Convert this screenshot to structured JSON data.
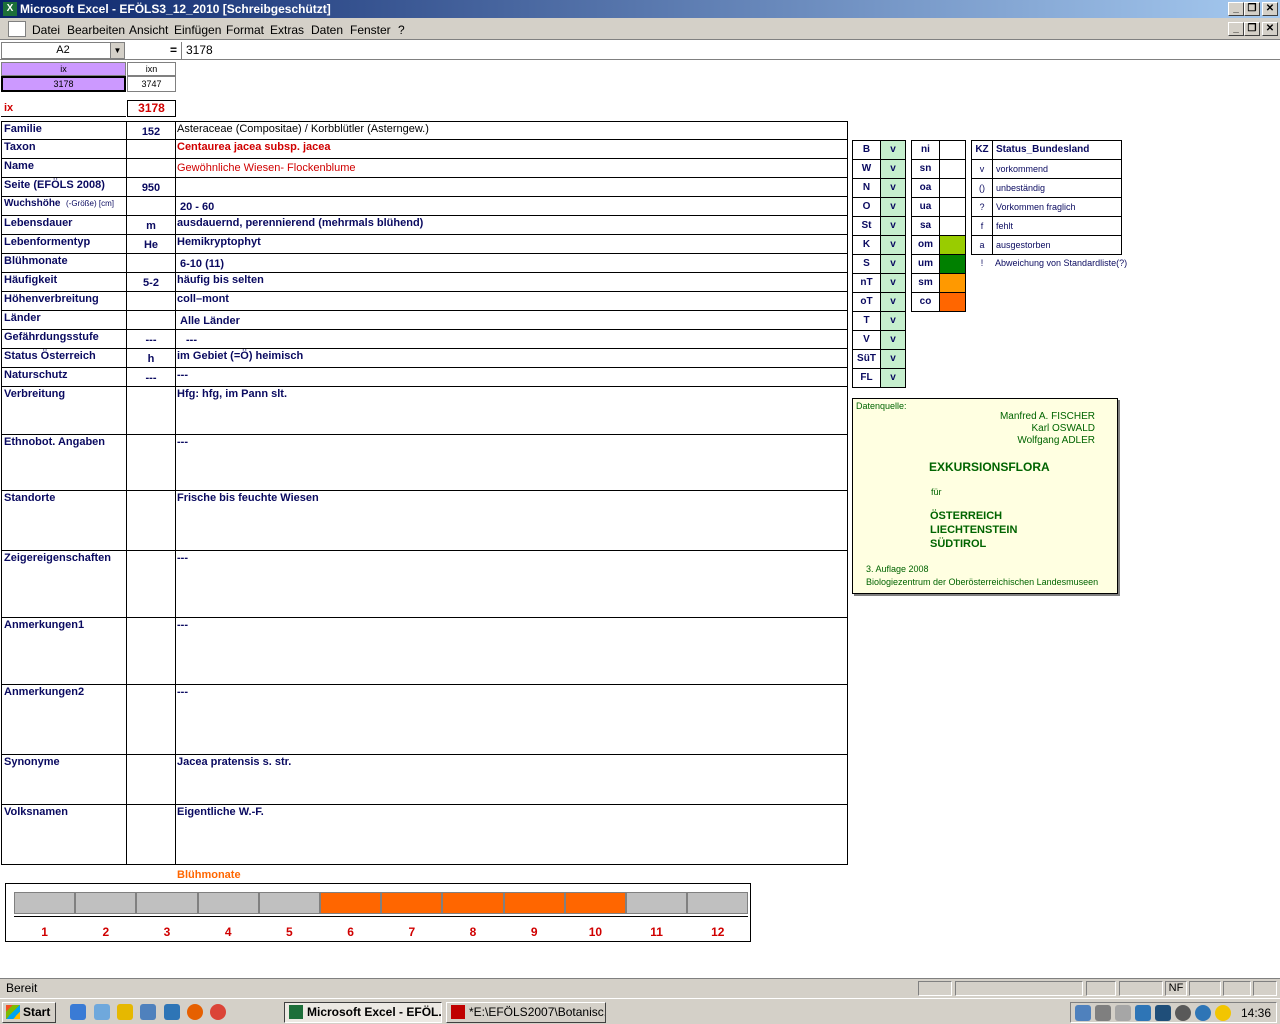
{
  "window": {
    "title": "Microsoft Excel - EFÖLS3_12_2010  [Schreibgeschützt]"
  },
  "menu": [
    "Datei",
    "Bearbeiten",
    "Ansicht",
    "Einfügen",
    "Format",
    "Extras",
    "Daten",
    "Fenster",
    "?"
  ],
  "formula": {
    "namebox": "A2",
    "eq": "=",
    "value": "3178"
  },
  "topcells": {
    "ix_h": "ix",
    "ixn_h": "ixn",
    "ix_v": "3178",
    "ixn_v": "3747",
    "ix_label": "ix",
    "ix_big": "3178"
  },
  "fields": [
    {
      "label": "Familie",
      "code": "152",
      "value": "Asteraceae (Compositae)  /  Korbblütler (Asterngew.)"
    },
    {
      "label": "Taxon",
      "code": "",
      "value": "Centaurea jacea subsp. jacea"
    },
    {
      "label": "Name",
      "code": "",
      "value": "Gewöhnliche Wiesen- Flockenblume"
    },
    {
      "label": "Seite (EFÖLS 2008)",
      "code": "950",
      "value": ""
    },
    {
      "label": "Wuchshöhe",
      "label_small": "(-Größe) [cm]",
      "code": "",
      "value": "20 - 60"
    },
    {
      "label": "Lebensdauer",
      "code": "m",
      "value": "ausdauernd, perennierend (mehrmals blühend)"
    },
    {
      "label": "Lebenformentyp",
      "code": "He",
      "value": "Hemikryptophyt"
    },
    {
      "label": "Blühmonate",
      "code": "",
      "value": "6-10 (11)"
    },
    {
      "label": "Häufigkeit",
      "code": "5-2",
      "value": "häufig bis selten"
    },
    {
      "label": "Höhenverbreitung",
      "code": "",
      "value": "coll–mont"
    },
    {
      "label": "Länder",
      "code": "",
      "value": "Alle Länder"
    },
    {
      "label": "Gefährdungsstufe",
      "code": "---",
      "value": "---"
    },
    {
      "label": "Status Österreich",
      "code": "h",
      "value": "im Gebiet (=Ö) heimisch"
    },
    {
      "label": "Naturschutz",
      "code": "---",
      "value": "---"
    },
    {
      "label": "Verbreitung",
      "code": "",
      "value": "Hfg:  hfg, im Pann slt."
    },
    {
      "label": "Ethnobot. Angaben",
      "code": "",
      "value": "---"
    },
    {
      "label": "Standorte",
      "code": "",
      "value": "Frische bis feuchte Wiesen"
    },
    {
      "label": "Zeigereigenschaften",
      "code": "",
      "value": "---"
    },
    {
      "label": "Anmerkungen1",
      "code": "",
      "value": "---"
    },
    {
      "label": "Anmerkungen2",
      "code": "",
      "value": "---"
    },
    {
      "label": "Synonyme",
      "code": "",
      "value": "Jacea pratensis s. str."
    },
    {
      "label": "Volksnamen",
      "code": "",
      "value": "Eigentliche W.-F."
    }
  ],
  "regions": [
    {
      "k": "B",
      "v": "v"
    },
    {
      "k": "W",
      "v": "v"
    },
    {
      "k": "N",
      "v": "v"
    },
    {
      "k": "O",
      "v": "v"
    },
    {
      "k": "St",
      "v": "v"
    },
    {
      "k": "K",
      "v": "v"
    },
    {
      "k": "S",
      "v": "v"
    },
    {
      "k": "nT",
      "v": "v"
    },
    {
      "k": "oT",
      "v": "v"
    },
    {
      "k": "T",
      "v": "v"
    },
    {
      "k": "V",
      "v": "v"
    },
    {
      "k": "SüT",
      "v": "v"
    },
    {
      "k": "FL",
      "v": "v"
    }
  ],
  "altitude": [
    {
      "k": "ni",
      "color": ""
    },
    {
      "k": "sn",
      "color": ""
    },
    {
      "k": "oa",
      "color": ""
    },
    {
      "k": "ua",
      "color": ""
    },
    {
      "k": "sa",
      "color": ""
    },
    {
      "k": "om",
      "color": "#99cc00"
    },
    {
      "k": "um",
      "color": "#008000"
    },
    {
      "k": "sm",
      "color": "#ff9900"
    },
    {
      "k": "co",
      "color": "#ff6600"
    }
  ],
  "legend": {
    "head_k": "KZ",
    "head_v": "Status_Bundesland",
    "rows": [
      {
        "k": "v",
        "v": "vorkommend"
      },
      {
        "k": "()",
        "v": "unbeständig"
      },
      {
        "k": "?",
        "v": "Vorkommen fraglich"
      },
      {
        "k": "f",
        "v": "fehlt"
      },
      {
        "k": "a",
        "v": "ausgestorben"
      },
      {
        "k": "!",
        "v": "Abweichung von Standardliste(?)"
      }
    ]
  },
  "source": {
    "label": "Datenquelle:",
    "authors": [
      "Manfred A. FISCHER",
      "Karl OSWALD",
      "Wolfgang ADLER"
    ],
    "title": "EXKURSIONSFLORA",
    "fuer": "für",
    "countries": [
      "ÖSTERREICH",
      "LIECHTENSTEIN",
      "SÜDTIROL"
    ],
    "edition": "3. Auflage 2008",
    "publisher": "Biologiezentrum der Oberösterreichischen Landesmuseen"
  },
  "bloom": {
    "title": "Blühmonate",
    "months": [
      "1",
      "2",
      "3",
      "4",
      "5",
      "6",
      "7",
      "8",
      "9",
      "10",
      "11",
      "12"
    ],
    "active": [
      6,
      7,
      8,
      9,
      10
    ],
    "active_color": "#ff6600",
    "inactive_color": "#c0c0c0"
  },
  "status": {
    "text": "Bereit",
    "nf": "NF"
  },
  "taskbar": {
    "start": "Start",
    "tasks": [
      "Microsoft Excel - EFÖL...",
      "*E:\\EFÖLS2007\\Botanisc..."
    ],
    "clock": "14:36"
  }
}
